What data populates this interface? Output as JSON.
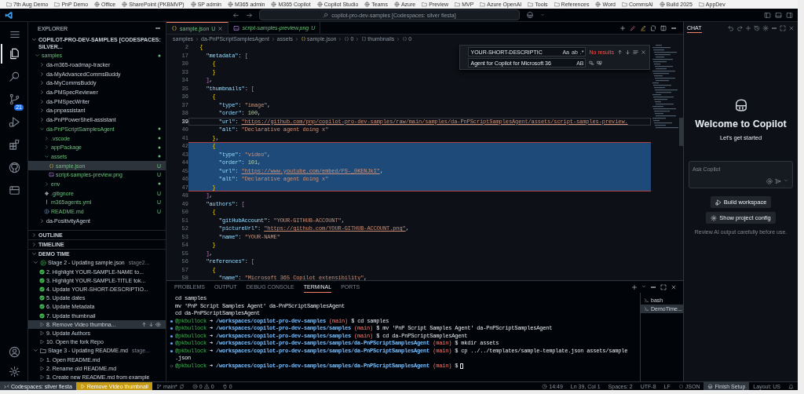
{
  "bookmarks": [
    {
      "label": "7th Aug Demo",
      "kind": "folder"
    },
    {
      "label": "PnP Demo",
      "kind": "folder"
    },
    {
      "label": "Office",
      "kind": "site"
    },
    {
      "label": "SharePoint (PKBMVP)",
      "kind": "site"
    },
    {
      "label": "SP admin",
      "kind": "site"
    },
    {
      "label": "M365 admin",
      "kind": "site"
    },
    {
      "label": "M365 Copilot",
      "kind": "site"
    },
    {
      "label": "Copilot Studio",
      "kind": "site"
    },
    {
      "label": "Teams",
      "kind": "site"
    },
    {
      "label": "Azure",
      "kind": "site"
    },
    {
      "label": "Preview",
      "kind": "folder"
    },
    {
      "label": "MVP",
      "kind": "folder"
    },
    {
      "label": "Azure OpenAI",
      "kind": "folder"
    },
    {
      "label": "Tools",
      "kind": "folder"
    },
    {
      "label": "References",
      "kind": "folder"
    },
    {
      "label": "Word",
      "kind": "site"
    },
    {
      "label": "CommsAI",
      "kind": "folder"
    },
    {
      "label": "Build 2025",
      "kind": "site"
    },
    {
      "label": "AppDev",
      "kind": "folder"
    }
  ],
  "title_bar": {
    "search": "copilot-pro-dev-samples [Codespaces: silver fiesta]"
  },
  "activity_bar": {
    "items": [
      {
        "kind": "explorer",
        "selected": true
      },
      {
        "kind": "search",
        "selected": false
      },
      {
        "kind": "source-control",
        "selected": false,
        "badge": "21"
      },
      {
        "kind": "run",
        "selected": false
      },
      {
        "kind": "extensions",
        "selected": false
      },
      {
        "kind": "github",
        "selected": false
      },
      {
        "kind": "toolkit",
        "selected": false
      }
    ]
  },
  "sidebar": {
    "title": "EXPLORER",
    "root": {
      "label": "COPILOT-PRO-DEV-SAMPLES [CODESPACES: SILVER...",
      "expanded": true
    },
    "tree": [
      {
        "label": "samples",
        "kind": "folder",
        "expanded": true,
        "dot": true,
        "selected": false,
        "children": [
          {
            "label": "da-m365-roadmap-tracker",
            "kind": "folder",
            "expanded": false,
            "dot": false,
            "selected": false
          },
          {
            "label": "da-MyAdvancedCommsBuddy",
            "kind": "folder",
            "expanded": false,
            "dot": false,
            "selected": false
          },
          {
            "label": "da-MyCommsBuddy",
            "kind": "folder",
            "expanded": false,
            "dot": false,
            "selected": false
          },
          {
            "label": "da-PMSpecReviewer",
            "kind": "folder",
            "expanded": false,
            "dot": false,
            "selected": false
          },
          {
            "label": "da-PMSpecWriter",
            "kind": "folder",
            "expanded": false,
            "dot": false,
            "selected": false
          },
          {
            "label": "da-pnpassistant",
            "kind": "folder",
            "expanded": false,
            "dot": false,
            "selected": false
          },
          {
            "label": "da-PnPPowerShell-assistant",
            "kind": "folder",
            "expanded": false,
            "dot": false,
            "selected": false
          },
          {
            "label": "da-PnPScriptSamplesAgent",
            "kind": "folder",
            "expanded": true,
            "dot": true,
            "selected": false,
            "children": [
              {
                "label": ".vscode",
                "kind": "folder",
                "expanded": false,
                "dot": true,
                "selected": false
              },
              {
                "label": "appPackage",
                "kind": "folder",
                "expanded": false,
                "dot": true,
                "selected": false
              },
              {
                "label": "assets",
                "kind": "folder",
                "expanded": true,
                "dot": true,
                "selected": false,
                "children": [
                  {
                    "label": "sample.json",
                    "kind": "json",
                    "badge": "U",
                    "selected": true
                  },
                  {
                    "label": "script-samples-preview.png",
                    "kind": "image",
                    "badge": "U",
                    "selected": false
                  }
                ]
              },
              {
                "label": "env",
                "kind": "folder",
                "expanded": false,
                "dot": true,
                "selected": false
              },
              {
                "label": ".gitignore",
                "kind": "gitignore",
                "badge": "U",
                "selected": false
              },
              {
                "label": "m365agents.yml",
                "kind": "yaml",
                "badge": "U",
                "selected": false
              },
              {
                "label": "README.md",
                "kind": "info",
                "badge": "U",
                "selected": false
              }
            ]
          },
          {
            "label": "da-PositivityAgent",
            "kind": "folder",
            "expanded": false,
            "dot": false,
            "selected": false
          }
        ]
      }
    ],
    "sections": [
      {
        "label": "OUTLINE",
        "expanded": false
      },
      {
        "label": "TIMELINE",
        "expanded": false
      },
      {
        "label": "DEMO TIME",
        "expanded": true,
        "children": [
          {
            "label": "Stage 2 - Updating sample.json",
            "description": "stage2...",
            "running": true,
            "expanded": true,
            "children": [
              {
                "label": "2. Highlight YOUR-SAMPLE-NAME to...",
                "done": true,
                "selected": false
              },
              {
                "label": "3. Highlight YOUR-SAMPLE-TITLE tok...",
                "done": true,
                "selected": false
              },
              {
                "label": "4. Update YOUR-SHORT-DESCRIPTIO...",
                "done": true,
                "selected": false
              },
              {
                "label": "5. Update dates",
                "done": true,
                "selected": false
              },
              {
                "label": "6. Update Metadata",
                "done": true,
                "selected": false
              },
              {
                "label": "7. Update thumbnail",
                "done": true,
                "selected": false
              },
              {
                "label": "8. Remove Video thumbna...",
                "done": false,
                "selected": true
              },
              {
                "label": "9. Update Authors",
                "done": false,
                "selected": false
              },
              {
                "label": "10. Open the fork Repo",
                "done": false,
                "selected": false
              }
            ]
          },
          {
            "label": "Stage 3 - Updating README.md",
            "description": "stage...",
            "running": false,
            "expanded": true,
            "children": [
              {
                "label": "1. Open README.md",
                "done": false,
                "selected": false
              },
              {
                "label": "2. Rename old README.md",
                "done": false,
                "selected": false
              },
              {
                "label": "3. Create new README.md from example",
                "done": false,
                "selected": false
              }
            ]
          }
        ]
      }
    ]
  },
  "editor": {
    "tabs": [
      {
        "label": "sample.json",
        "status": "U",
        "kind": "json",
        "preview": false,
        "selected": true
      },
      {
        "label": "script-samples-preview.png",
        "status": "U",
        "kind": "image",
        "preview": true,
        "selected": false
      }
    ],
    "breadcrumbs": [
      {
        "label": "samples",
        "kind": "folder"
      },
      {
        "label": "da-PnPScriptSamplesAgent",
        "kind": "folder"
      },
      {
        "label": "assets",
        "kind": "folder"
      },
      {
        "label": "sample.json",
        "kind": "json"
      },
      {
        "label": "0",
        "kind": "object"
      },
      {
        "label": "thumbnails",
        "kind": "array"
      },
      {
        "label": "0",
        "kind": "object"
      }
    ],
    "find": {
      "find_value": "YOUR-SHORT-DESCRIPTIC",
      "find_toggles": [
        "Aa",
        "ab",
        ".*"
      ],
      "result": "No results",
      "replace_value": "Agent for Copilot for Microsoft 36",
      "replace_toggles": [
        "AB"
      ]
    },
    "lines": [
      {
        "number": "2",
        "text": "  {",
        "selected": false,
        "current": false
      },
      {
        "number": "17",
        "text": "    \"metadata\": [",
        "selected": false,
        "current": false
      },
      {
        "number": "30",
        "text": "      {",
        "selected": false,
        "current": false
      },
      {
        "number": "33",
        "text": "      }",
        "selected": false,
        "current": false
      },
      {
        "number": "34",
        "text": "    ],",
        "selected": false,
        "current": false
      },
      {
        "number": "35",
        "text": "    \"thumbnails\": [",
        "selected": false,
        "current": false
      },
      {
        "number": "36",
        "text": "      {",
        "selected": false,
        "current": false
      },
      {
        "number": "37",
        "text": "        \"type\": \"image\",",
        "selected": false,
        "current": false
      },
      {
        "number": "38",
        "text": "        \"order\": 100,",
        "selected": false,
        "current": false
      },
      {
        "number": "39",
        "text": "        \"url\": \"https://github.com/pnp/copilot-pro-dev-samples/raw/main/samples/da-PnPScriptSamplesAgent/assets/script-samples-preview.",
        "selected": false,
        "current": true,
        "link": true
      },
      {
        "number": "40",
        "text": "        \"alt\": \"Declarative agent doing x\"",
        "selected": false,
        "current": false
      },
      {
        "number": "41",
        "text": "      },",
        "selected": false,
        "current": false
      },
      {
        "number": "42",
        "text": "      {",
        "selected": true,
        "current": false
      },
      {
        "number": "43",
        "text": "        \"type\": \"video\",",
        "selected": true,
        "current": false
      },
      {
        "number": "44",
        "text": "        \"order\": 101,",
        "selected": true,
        "current": false
      },
      {
        "number": "45",
        "text": "        \"url\": \"https://www.youtube.com/embed/FS-_0KENJkI\",",
        "selected": true,
        "current": false,
        "link": true
      },
      {
        "number": "46",
        "text": "        \"alt\": \"Declarative agent doing x\"",
        "selected": true,
        "current": false
      },
      {
        "number": "47",
        "text": "      }",
        "selected": true,
        "current": false
      },
      {
        "number": "48",
        "text": "    ],",
        "selected": false,
        "current": false
      },
      {
        "number": "49",
        "text": "    \"authors\": [",
        "selected": false,
        "current": false
      },
      {
        "number": "50",
        "text": "      {",
        "selected": false,
        "current": false
      },
      {
        "number": "51",
        "text": "        \"gitHubAccount\": \"YOUR-GITHUB-ACCOUNT\",",
        "selected": false,
        "current": false
      },
      {
        "number": "52",
        "text": "        \"pictureUrl\": \"https://github.com/YOUR-GITHUB-ACCOUNT.png\",",
        "selected": false,
        "current": false,
        "link": true
      },
      {
        "number": "53",
        "text": "        \"name\": \"YOUR-NAME\"",
        "selected": false,
        "current": false
      },
      {
        "number": "54",
        "text": "      }",
        "selected": false,
        "current": false
      },
      {
        "number": "55",
        "text": "    ],",
        "selected": false,
        "current": false
      },
      {
        "number": "56",
        "text": "    \"references\": [",
        "selected": false,
        "current": false
      },
      {
        "number": "57",
        "text": "      {",
        "selected": false,
        "current": false
      },
      {
        "number": "58",
        "text": "        \"name\": \"Microsoft 365 Copilot extensibility\",",
        "selected": false,
        "current": false
      }
    ]
  },
  "panel": {
    "tabs": [
      {
        "label": "PROBLEMS",
        "selected": false
      },
      {
        "label": "OUTPUT",
        "selected": false
      },
      {
        "label": "DEBUG CONSOLE",
        "selected": false
      },
      {
        "label": "TERMINAL",
        "selected": true
      },
      {
        "label": "PORTS",
        "selected": false
      }
    ],
    "terminal_lines": [
      {
        "kind": "plain",
        "text": "cd samples"
      },
      {
        "kind": "plain",
        "text": "mv 'PnP Script Samples Agent' da-PnPScriptSamplesAgent"
      },
      {
        "kind": "plain",
        "text": "cd da-PnPScriptSamplesAgent"
      },
      {
        "kind": "prompt",
        "done": true,
        "user": "@pkbullock",
        "arrow": "➜",
        "path": "/workspaces/copilot-pro-dev-samples",
        "branch": "(main)",
        "command": "$ cd samples"
      },
      {
        "kind": "prompt",
        "done": true,
        "user": "@pkbullock",
        "arrow": "➜",
        "path": "/workspaces/copilot-pro-dev-samples/samples",
        "branch": "(main)",
        "command": "$ mv 'PnP Script Samples Agent' da-PnPScriptSamplesAgent"
      },
      {
        "kind": "prompt",
        "done": true,
        "user": "@pkbullock",
        "arrow": "➜",
        "path": "/workspaces/copilot-pro-dev-samples/samples",
        "branch": "(main)",
        "command": "$ cd da-PnPScriptSamplesAgent"
      },
      {
        "kind": "prompt",
        "done": true,
        "user": "@pkbullock",
        "arrow": "➜",
        "path": "/workspaces/copilot-pro-dev-samples/samples/da-PnPScriptSamplesAgent",
        "branch": "(main)",
        "command": "$ mkdir assets"
      },
      {
        "kind": "prompt",
        "done": true,
        "user": "@pkbullock",
        "arrow": "➜",
        "path": "/workspaces/copilot-pro-dev-samples/samples/da-PnPScriptSamplesAgent",
        "branch": "(main)",
        "command": "$ cp ../../templates/sample-template.json assets/sample"
      },
      {
        "kind": "plain",
        "text": ".json"
      },
      {
        "kind": "prompt",
        "done": false,
        "user": "@pkbullock",
        "arrow": "➜",
        "path": "/workspaces/copilot-pro-dev-samples/samples/da-PnPScriptSamplesAgent",
        "branch": "(main)",
        "command": "$",
        "cursor": true
      }
    ],
    "terminals": [
      {
        "label": "bash",
        "selected": false
      },
      {
        "label": "DemoTime...",
        "selected": true
      }
    ]
  },
  "chat": {
    "title": "CHAT",
    "heading": "Welcome to Copilot",
    "subheading": "Let's get started",
    "input": {
      "placeholder": "Ask Copilot"
    },
    "actions": [
      {
        "label": "Build workspace",
        "kind": "build"
      },
      {
        "label": "Show project config",
        "kind": "config"
      }
    ],
    "disclaimer": "Review AI output carefully before use."
  },
  "status_bar": {
    "remote": "Codespaces: silver fiesta",
    "demo": "Remove Video thumbnail",
    "branch": "main*",
    "errors": "0",
    "warnings": "0",
    "ports": "0",
    "time": "14:49",
    "position": "Ln 39, Col 1",
    "indent": "Spaces: 2",
    "encoding": "UTF-8",
    "eol": "LF",
    "language": "JSON",
    "copilot": "Finish Setup",
    "layout": "Layout: US"
  }
}
